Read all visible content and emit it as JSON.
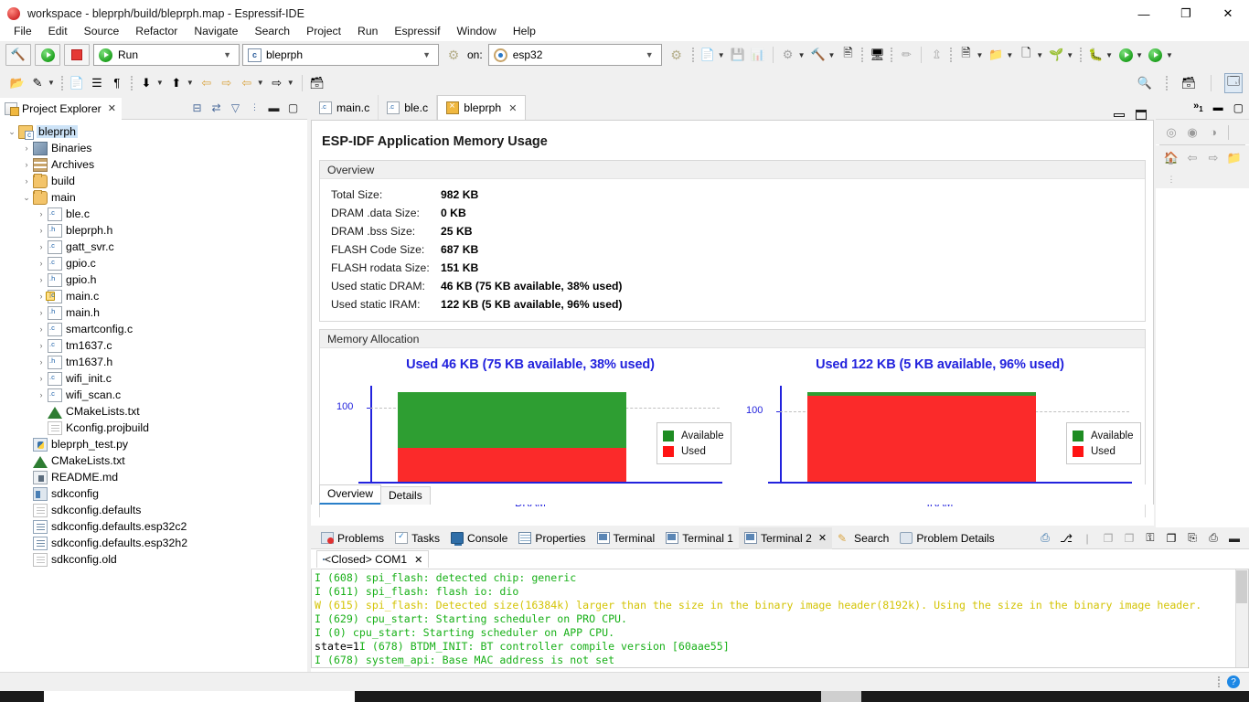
{
  "window": {
    "title": "workspace - bleprph/build/bleprph.map - Espressif-IDE",
    "app_icon": "espressif-logo-icon",
    "minimize": "—",
    "maximize": "❐",
    "close": "✕"
  },
  "menu": {
    "items": [
      "File",
      "Edit",
      "Source",
      "Refactor",
      "Navigate",
      "Search",
      "Project",
      "Run",
      "Espressif",
      "Window",
      "Help"
    ]
  },
  "toolbar": {
    "build_button": "build-hammer-button",
    "run_button": "run-button",
    "stop_button": "stop-button",
    "launch_mode": "Run",
    "launch_config": "bleprph",
    "on_label": "on:",
    "target": "esp32",
    "icons": [
      "open-project-icon",
      "pencil-edit-icon",
      "dropdown-caret",
      "indent-icon",
      "list-icon",
      "paragraph-icon",
      "save-as-icon",
      "export-icon",
      "mark-occurrence-next-icon",
      "mark-occurrence-prev-icon",
      "back-nav-icon",
      "forward-nav-icon",
      "new-window-icon",
      "new-file-icon",
      "save-icon",
      "save-all-icon",
      "build-settings-icon",
      "hammer-build-icon",
      "binary-010-icon",
      "terminal-monitor-icon",
      "erase-flash-icon",
      "upload-icon",
      "new-c-project-icon",
      "new-component-icon",
      "new-c-file-icon",
      "new-git-icon",
      "debug-bug-icon",
      "run-play-icon",
      "run-coverage-icon",
      "search-magnifier-icon",
      "new-perspective-icon",
      "open-perspective-icon"
    ]
  },
  "explorer": {
    "title": "Project Explorer",
    "close": "✕",
    "tools": [
      "collapse-all-icon",
      "link-with-editor-icon",
      "filter-icon",
      "view-menu-icon",
      "minimize-icon",
      "maximize-icon"
    ],
    "tree": [
      {
        "label": "bleprph",
        "indent": 0,
        "twisty": "⌄",
        "icon": "ic-proj",
        "selected": true
      },
      {
        "label": "Binaries",
        "indent": 1,
        "twisty": "›",
        "icon": "ic-bin"
      },
      {
        "label": "Archives",
        "indent": 1,
        "twisty": "›",
        "icon": "ic-arch"
      },
      {
        "label": "build",
        "indent": 1,
        "twisty": "›",
        "icon": "ic-folder"
      },
      {
        "label": "main",
        "indent": 1,
        "twisty": "⌄",
        "icon": "ic-folder"
      },
      {
        "label": "ble.c",
        "indent": 2,
        "twisty": "›",
        "icon": "ic-c"
      },
      {
        "label": "bleprph.h",
        "indent": 2,
        "twisty": "›",
        "icon": "ic-h"
      },
      {
        "label": "gatt_svr.c",
        "indent": 2,
        "twisty": "›",
        "icon": "ic-c"
      },
      {
        "label": "gpio.c",
        "indent": 2,
        "twisty": "›",
        "icon": "ic-c"
      },
      {
        "label": "gpio.h",
        "indent": 2,
        "twisty": "›",
        "icon": "ic-h"
      },
      {
        "label": "main.c",
        "indent": 2,
        "twisty": "›",
        "icon": "ic-c ic-warn"
      },
      {
        "label": "main.h",
        "indent": 2,
        "twisty": "›",
        "icon": "ic-h"
      },
      {
        "label": "smartconfig.c",
        "indent": 2,
        "twisty": "›",
        "icon": "ic-c"
      },
      {
        "label": "tm1637.c",
        "indent": 2,
        "twisty": "›",
        "icon": "ic-c"
      },
      {
        "label": "tm1637.h",
        "indent": 2,
        "twisty": "›",
        "icon": "ic-h"
      },
      {
        "label": "wifi_init.c",
        "indent": 2,
        "twisty": "›",
        "icon": "ic-c"
      },
      {
        "label": "wifi_scan.c",
        "indent": 2,
        "twisty": "›",
        "icon": "ic-c"
      },
      {
        "label": "CMakeLists.txt",
        "indent": 2,
        "twisty": "",
        "icon": "ic-cmake"
      },
      {
        "label": "Kconfig.projbuild",
        "indent": 2,
        "twisty": "",
        "icon": "ic-doc"
      },
      {
        "label": "bleprph_test.py",
        "indent": 1,
        "twisty": "",
        "icon": "ic-py"
      },
      {
        "label": "CMakeLists.txt",
        "indent": 1,
        "twisty": "",
        "icon": "ic-cmake"
      },
      {
        "label": "README.md",
        "indent": 1,
        "twisty": "",
        "icon": "ic-md"
      },
      {
        "label": "sdkconfig",
        "indent": 1,
        "twisty": "",
        "icon": "ic-sdk"
      },
      {
        "label": "sdkconfig.defaults",
        "indent": 1,
        "twisty": "",
        "icon": "ic-doc"
      },
      {
        "label": "sdkconfig.defaults.esp32c2",
        "indent": 1,
        "twisty": "",
        "icon": "ic-doc2"
      },
      {
        "label": "sdkconfig.defaults.esp32h2",
        "indent": 1,
        "twisty": "",
        "icon": "ic-doc2"
      },
      {
        "label": "sdkconfig.old",
        "indent": 1,
        "twisty": "",
        "icon": "ic-doc"
      }
    ]
  },
  "editor": {
    "tabs": [
      {
        "label": "main.c",
        "icon": "ic-c",
        "active": false,
        "closable": false
      },
      {
        "label": "ble.c",
        "icon": "ic-c",
        "active": false,
        "closable": false
      },
      {
        "label": "bleprph",
        "icon": "ic-map",
        "active": true,
        "closable": true
      }
    ],
    "tab_close": "✕",
    "minimize": "minimize-icon",
    "maximize": "maximize-icon",
    "page_title": "ESP-IDF Application Memory Usage",
    "overview_header": "Overview",
    "overview_rows": [
      {
        "key": "Total Size:",
        "value": "982 KB"
      },
      {
        "key": "DRAM .data Size:",
        "value": "0 KB"
      },
      {
        "key": "DRAM .bss Size:",
        "value": "25 KB"
      },
      {
        "key": "FLASH Code Size:",
        "value": "687 KB"
      },
      {
        "key": "FLASH rodata Size:",
        "value": "151 KB"
      },
      {
        "key": "Used static DRAM:",
        "value": "46 KB (75 KB available, 38%  used)"
      },
      {
        "key": "Used static IRAM:",
        "value": "122 KB (5 KB available, 96%  used)"
      }
    ],
    "allocation_header": "Memory Allocation",
    "bottom_tabs": [
      {
        "label": "Overview",
        "active": true
      },
      {
        "label": "Details",
        "active": false
      }
    ]
  },
  "chart_data": [
    {
      "type": "bar",
      "title": "Used 46 KB (75 KB available, 38%  used)",
      "categories": [
        "DRAM"
      ],
      "series": [
        {
          "name": "Available",
          "values": [
            75
          ],
          "color": "#2e9e32"
        },
        {
          "name": "Used",
          "values": [
            46
          ],
          "color": "#fb2a2a"
        }
      ],
      "stacked": true,
      "total": 121,
      "used_percent": 38,
      "ylabel": "",
      "xlabel": "DRAM",
      "yticks": [
        "100"
      ],
      "ylim": [
        0,
        130
      ],
      "legend": [
        "Available",
        "Used"
      ],
      "legend_position": "right",
      "grid": true,
      "title_color": "#2222dd",
      "axis_color": "#2222dd"
    },
    {
      "type": "bar",
      "title": "Used 122 KB (5 KB available, 96%  used)",
      "categories": [
        "IRAM"
      ],
      "series": [
        {
          "name": "Available",
          "values": [
            5
          ],
          "color": "#2e9e32"
        },
        {
          "name": "Used",
          "values": [
            122
          ],
          "color": "#fb2a2a"
        }
      ],
      "stacked": true,
      "total": 127,
      "used_percent": 96,
      "ylabel": "",
      "xlabel": "IRAM",
      "yticks": [
        "100"
      ],
      "ylim": [
        0,
        136
      ],
      "legend": [
        "Available",
        "Used"
      ],
      "legend_position": "right",
      "grid": true,
      "title_color": "#2222dd",
      "axis_color": "#2222dd"
    }
  ],
  "right_sidebar": {
    "chevron": "»",
    "badge": "1",
    "minimize": "minimize-icon",
    "maximize": "maximize-icon",
    "icons_row1": [
      "add-breakpoint-icon",
      "view-breakpoint-icon",
      "skip-breakpoint-icon"
    ],
    "icons_row2": [
      "home-icon",
      "back-arrow-icon",
      "forward-arrow-icon",
      "close-folder-icon"
    ],
    "icons_row3": [
      "view-menu-icon"
    ]
  },
  "console": {
    "tabs": [
      {
        "label": "Problems",
        "icon": "ci-prob",
        "active": false,
        "closable": false
      },
      {
        "label": "Tasks",
        "icon": "ci-task",
        "active": false,
        "closable": false
      },
      {
        "label": "Console",
        "icon": "ci-cons",
        "active": false,
        "closable": false
      },
      {
        "label": "Properties",
        "icon": "ci-prop",
        "active": false,
        "closable": false
      },
      {
        "label": "Terminal",
        "icon": "ci-term",
        "active": false,
        "closable": false
      },
      {
        "label": "Terminal 1",
        "icon": "ci-term",
        "active": false,
        "closable": false
      },
      {
        "label": "Terminal 2",
        "icon": "ci-term",
        "active": true,
        "closable": true
      },
      {
        "label": "Search",
        "icon": "ci-search",
        "active": false,
        "closable": false
      },
      {
        "label": "Problem Details",
        "icon": "ci-pd",
        "active": false,
        "closable": false
      }
    ],
    "tab_close": "✕",
    "tools": [
      "open-terminal-icon",
      "toggle-connection-icon",
      "copy-icon",
      "paste-special-icon",
      "lock-icon",
      "copy-all-icon",
      "paste-icon",
      "scroll-lock-icon",
      "minimize-icon",
      "maximize-icon"
    ],
    "sub_tab": {
      "label": "<Closed> COM1",
      "icon": "ci-cons",
      "close": "✕"
    },
    "lines": [
      {
        "text": "I (608) spi_flash: detected chip: generic",
        "color": "green"
      },
      {
        "text": "I (611) spi_flash: flash io: dio",
        "color": "green"
      },
      {
        "text": "W (615) spi_flash: Detected size(16384k) larger than the size in the binary image header(8192k). Using the size in the binary image header.",
        "color": "yellow"
      },
      {
        "text": "I (629) cpu_start: Starting scheduler on PRO CPU.",
        "color": "green"
      },
      {
        "text": "I (0) cpu_start: Starting scheduler on APP CPU.",
        "color": "green"
      },
      {
        "text": "state=1I (678) BTDM_INIT: BT controller compile version [60aae55]",
        "color": "mixed",
        "prefix": "state=1",
        "prefix_color": "black",
        "rest": "I (678) BTDM_INIT: BT controller compile version [60aae55]"
      },
      {
        "text": "I (678) system_api: Base MAC address is not set",
        "color": "green"
      }
    ]
  },
  "statusbar": {
    "help_icon": "help-icon",
    "text": ""
  }
}
